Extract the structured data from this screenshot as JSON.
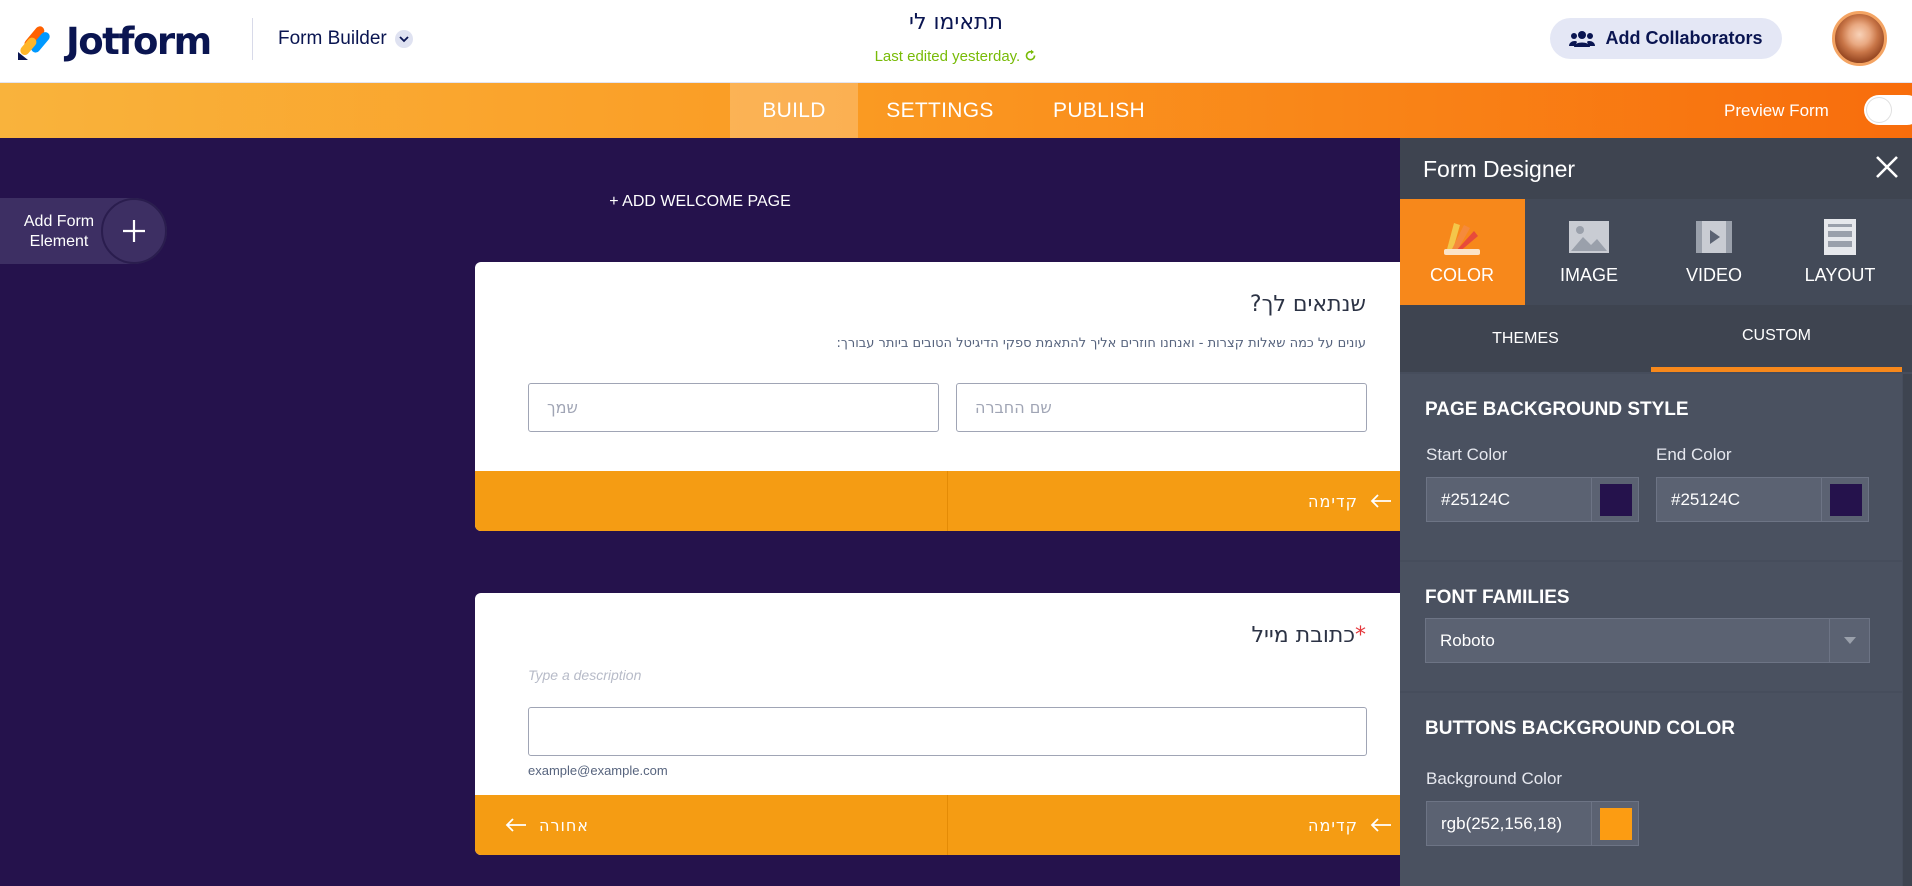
{
  "header": {
    "brand": "Jotform",
    "builder_menu": "Form Builder",
    "form_title": "תתאימו לי",
    "last_edited": "Last edited yesterday.",
    "collaborators_button": "Add Collaborators"
  },
  "nav": {
    "tabs": [
      "BUILD",
      "SETTINGS",
      "PUBLISH"
    ],
    "active_tab": "BUILD",
    "preview_label": "Preview Form"
  },
  "canvas": {
    "add_welcome": "+ ADD WELCOME PAGE",
    "add_element_label": "Add Form Element",
    "card1": {
      "title": "שנתאים לך?",
      "description": "עונים על כמה שאלות קצרות - ואנחנו חוזרים אליך להתאמת ספקי הדיגיטל הטובים ביותר עבורך:",
      "field_company_placeholder": "שם החברה",
      "field_name_placeholder": "שמך",
      "next_label": "קדימה"
    },
    "card2": {
      "title": "כתובת מייל",
      "required_mark": "*",
      "description_placeholder": "Type a description",
      "email_sublabel": "example@example.com",
      "next_label": "קדימה",
      "back_label": "אחורה"
    }
  },
  "panel": {
    "title": "Form Designer",
    "tabs": [
      "COLOR",
      "IMAGE",
      "VIDEO",
      "LAYOUT"
    ],
    "active_tab": "COLOR",
    "subtabs": [
      "THEMES",
      "CUSTOM"
    ],
    "active_subtab": "CUSTOM",
    "page_bg": {
      "heading": "PAGE BACKGROUND STYLE",
      "start_label": "Start Color",
      "start_value": "#25124C",
      "end_label": "End Color",
      "end_value": "#25124C"
    },
    "fonts": {
      "heading": "FONT FAMILIES",
      "value": "Roboto"
    },
    "buttons_bg": {
      "heading": "BUTTONS BACKGROUND COLOR",
      "label": "Background Color",
      "value": "rgb(252,156,18)"
    }
  },
  "colors": {
    "page_background": "#25124C",
    "accent_orange": "#F7881B",
    "button_orange": "#FC9C12",
    "panel_dark": "#464D5C",
    "edited_green": "#78BB07"
  }
}
